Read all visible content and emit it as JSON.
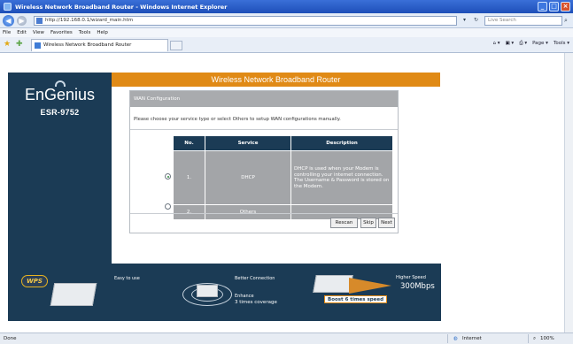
{
  "window": {
    "title": "Wireless Network Broadband Router - Windows Internet Explorer",
    "address": "http://192.168.0.1/wizard_main.htm",
    "search_placeholder": "Live Search"
  },
  "menu": [
    "File",
    "Edit",
    "View",
    "Favorites",
    "Tools",
    "Help"
  ],
  "tab": {
    "label": "Wireless Network Broadband Router"
  },
  "commandbar": {
    "home": "⌂ ▾",
    "feeds": "▣ ▾",
    "print": "⎙ ▾",
    "page": "Page ▾",
    "tools": "Tools ▾"
  },
  "brand": {
    "logo": "EnGenius",
    "model": "ESR-9752"
  },
  "header": "Wireless Network Broadband Router",
  "wan": {
    "title": "WAN Configuration",
    "instruction": "Please choose your service type or select Others to setup WAN configurations manually.",
    "columns": [
      "No.",
      "Service",
      "Description"
    ],
    "rows": [
      {
        "no": "1.",
        "service": "DHCP",
        "description": "DHCP is used when your Modem is controlling your internet connection. The Username & Password is stored on the Modem.",
        "selected": true
      },
      {
        "no": "2.",
        "service": "Others",
        "description": "",
        "selected": false
      }
    ],
    "buttons": {
      "rescan": "Rescan",
      "skip": "Skip",
      "next": "Next"
    }
  },
  "banner": {
    "wps": "WPS",
    "easy": "Easy to use",
    "better": "Better Connection",
    "enhance": "Enhance",
    "coverage": "3 times coverage",
    "higher": "Higher Speed",
    "speed": "300Mbps",
    "boost": "Boost 6 times speed"
  },
  "status": {
    "left": "Done",
    "zone": "Internet",
    "zoom": "100%"
  }
}
